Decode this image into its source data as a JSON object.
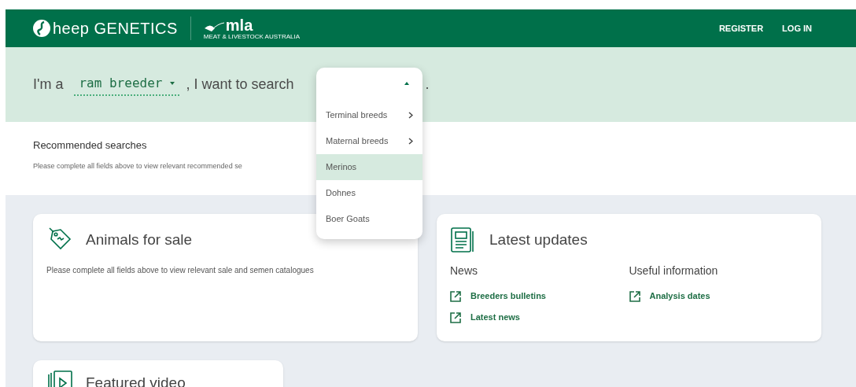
{
  "header": {
    "logo_text": "heep GENETICS",
    "partner_logo": "mla",
    "partner_tagline": "MEAT & LIVESTOCK AUSTRALIA",
    "nav": [
      "REGISTER",
      "LOG IN"
    ]
  },
  "search_sentence": {
    "prefix": "I'm a",
    "role": "ram breeder",
    "middle": ", I want to search",
    "suffix": ".",
    "dropdown": {
      "expanded": true,
      "options": [
        {
          "label": "Terminal breeds",
          "has_submenu": true,
          "selected": false
        },
        {
          "label": "Maternal breeds",
          "has_submenu": true,
          "selected": false
        },
        {
          "label": "Merinos",
          "has_submenu": false,
          "selected": true
        },
        {
          "label": "Dohnes",
          "has_submenu": false,
          "selected": false
        },
        {
          "label": "Boer Goats",
          "has_submenu": false,
          "selected": false
        }
      ]
    }
  },
  "recommended": {
    "title": "Recommended searches",
    "message": "Please complete all fields above to view relevant recommended se"
  },
  "cards": [
    {
      "kind": "sale",
      "title": "Animals for sale",
      "message": "Please complete all fields above to view relevant sale and semen catalogues"
    },
    {
      "kind": "updates",
      "title": "Latest updates",
      "columns": [
        {
          "heading": "News",
          "links": [
            "Breeders bulletins",
            "Latest news"
          ]
        },
        {
          "heading": "Useful information",
          "links": [
            "Analysis dates"
          ]
        }
      ]
    },
    {
      "kind": "video",
      "title": "Featured video"
    }
  ]
}
